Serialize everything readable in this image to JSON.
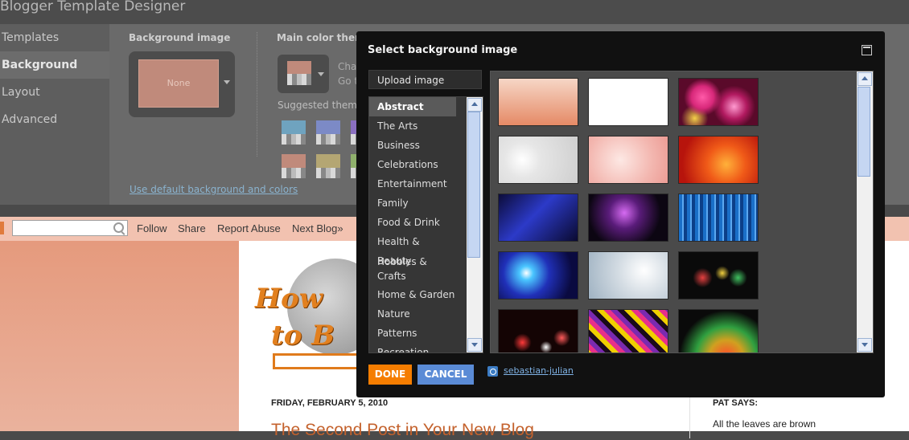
{
  "designer": {
    "title": "Blogger Template Designer",
    "nav": [
      {
        "label": "Templates"
      },
      {
        "label": "Background"
      },
      {
        "label": "Layout"
      },
      {
        "label": "Advanced"
      }
    ],
    "background_image_label": "Background image",
    "background_image_value": "None",
    "main_color_label": "Main color theme",
    "main_color_text_1": "Cha",
    "main_color_text_2": "Go t",
    "suggested_label": "Suggested theme",
    "default_link": "Use default background and colors",
    "suggested_colors": [
      "#6fa3bf",
      "#7c8ac6",
      "#8a6fc0",
      "#c08a7b",
      "#b4a673",
      "#8fb06c"
    ]
  },
  "navbar": {
    "search_placeholder": "",
    "links": [
      "Follow",
      "Share",
      "Report Abuse",
      "Next Blog»"
    ]
  },
  "blog": {
    "post_date": "FRIDAY, FEBRUARY 5, 2010",
    "post_title": "The Second Post in Your New Blog",
    "sidebar_heading": "PAT SAYS:",
    "sidebar_text": "All the leaves are brown",
    "logo_line1": "How",
    "logo_line2": "to B"
  },
  "dialog": {
    "title": "Select background image",
    "upload_label": "Upload image",
    "categories": [
      {
        "label": "Abstract",
        "selected": true
      },
      {
        "label": "The Arts"
      },
      {
        "label": "Business"
      },
      {
        "label": "Celebrations"
      },
      {
        "label": "Entertainment"
      },
      {
        "label": "Family"
      },
      {
        "label": "Food & Drink"
      },
      {
        "label": "Health & Beauty"
      },
      {
        "label": "Hobbies & Crafts"
      },
      {
        "label": "Home & Garden"
      },
      {
        "label": "Nature"
      },
      {
        "label": "Patterns"
      },
      {
        "label": "Recreation"
      }
    ],
    "done_label": "DONE",
    "cancel_label": "CANCEL",
    "credit_label": "sebastian-julian",
    "images": [
      {
        "name": "peach-gradient-thumbnail"
      },
      {
        "name": "white-plain-thumbnail"
      },
      {
        "name": "pink-bokeh-thumbnail"
      },
      {
        "name": "white-bokeh-thumbnail"
      },
      {
        "name": "pink-soft-bokeh-thumbnail"
      },
      {
        "name": "red-orange-bokeh-thumbnail"
      },
      {
        "name": "blue-fiber-light-thumbnail"
      },
      {
        "name": "purple-lightning-thumbnail"
      },
      {
        "name": "blue-vertical-lines-thumbnail"
      },
      {
        "name": "blue-burst-thumbnail"
      },
      {
        "name": "silver-swirl-thumbnail"
      },
      {
        "name": "rainbow-bokeh-dark-thumbnail"
      },
      {
        "name": "red-bokeh-dark-thumbnail"
      },
      {
        "name": "colorful-stripes-thumbnail"
      },
      {
        "name": "light-trails-thumbnail"
      }
    ]
  }
}
